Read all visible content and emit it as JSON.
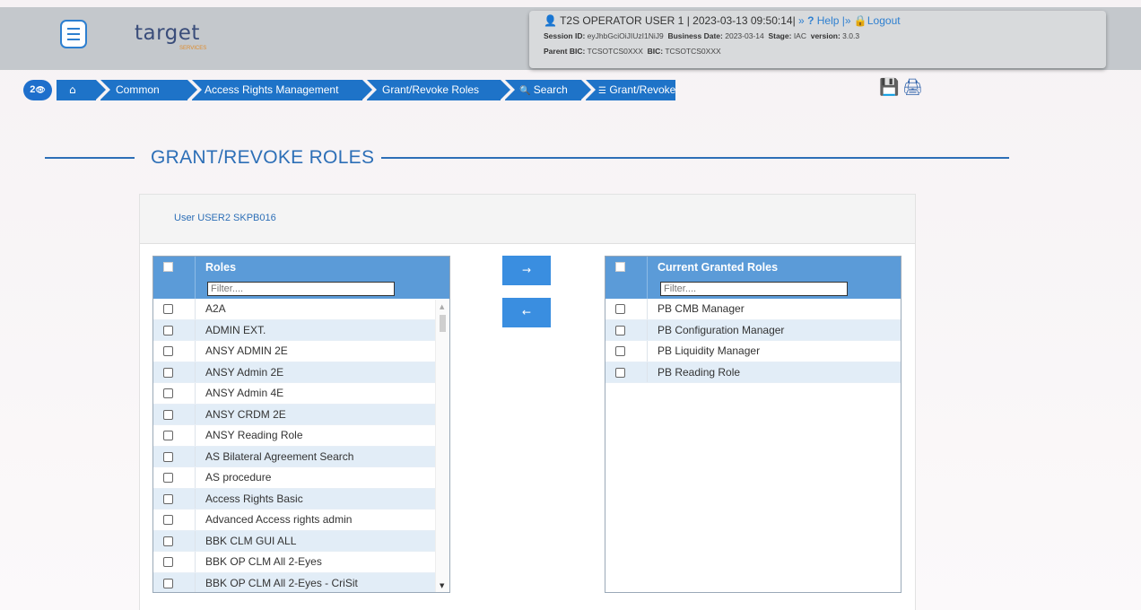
{
  "header": {
    "logo_text": "target",
    "logo_sub": "SERVICES",
    "user_icon": "user-icon",
    "user_name": "T2S OPERATOR USER 1",
    "datetime": "| 2023-03-13 09:50:14|",
    "help_prefix": "»",
    "help_label": "Help",
    "logout_prefix": "|»",
    "logout_label": "Logout",
    "session_label": "Session ID:",
    "session_value": "eyJhbGciOiJIUzI1NiJ9",
    "business_date_label": "Business Date:",
    "business_date_value": "2023-03-14",
    "stage_label": "Stage:",
    "stage_value": "IAC",
    "version_label": "version:",
    "version_value": "3.0.3",
    "parent_bic_label": "Parent BIC:",
    "parent_bic_value": "TCSOTCS0XXX",
    "bic_label": "BIC:",
    "bic_value": "TCSOTCS0XXX"
  },
  "breadcrumb": {
    "counter": "2",
    "home_icon": "home-icon",
    "items": [
      "Common",
      "Access Rights Management",
      "Grant/Revoke Roles",
      "Search",
      "Grant/Revoke"
    ]
  },
  "page": {
    "title": "GRANT/REVOKE ROLES",
    "user_label": "User USER2 SKPB016"
  },
  "left_table": {
    "header": "Roles",
    "filter_placeholder": "Filter....",
    "rows": [
      "A2A",
      "ADMIN EXT.",
      "ANSY ADMIN 2E",
      "ANSY Admin 2E",
      "ANSY Admin 4E",
      "ANSY CRDM 2E",
      "ANSY Reading Role",
      "AS Bilateral Agreement Search",
      "AS procedure",
      "Access Rights Basic",
      "Advanced Access rights admin",
      "BBK CLM GUI ALL",
      "BBK OP CLM All 2-Eyes",
      "BBK OP CLM All 2-Eyes - CriSit"
    ]
  },
  "right_table": {
    "header": "Current Granted Roles",
    "filter_placeholder": "Filter....",
    "rows": [
      "PB CMB Manager",
      "PB Configuration Manager",
      "PB Liquidity Manager",
      "PB Reading Role"
    ]
  },
  "buttons": {
    "grant": "→",
    "revoke": "←"
  },
  "colors": {
    "accent": "#1e73c8",
    "table_header": "#5b9bd8",
    "row_alt": "#e2edf7",
    "title": "#2d6fb7"
  }
}
